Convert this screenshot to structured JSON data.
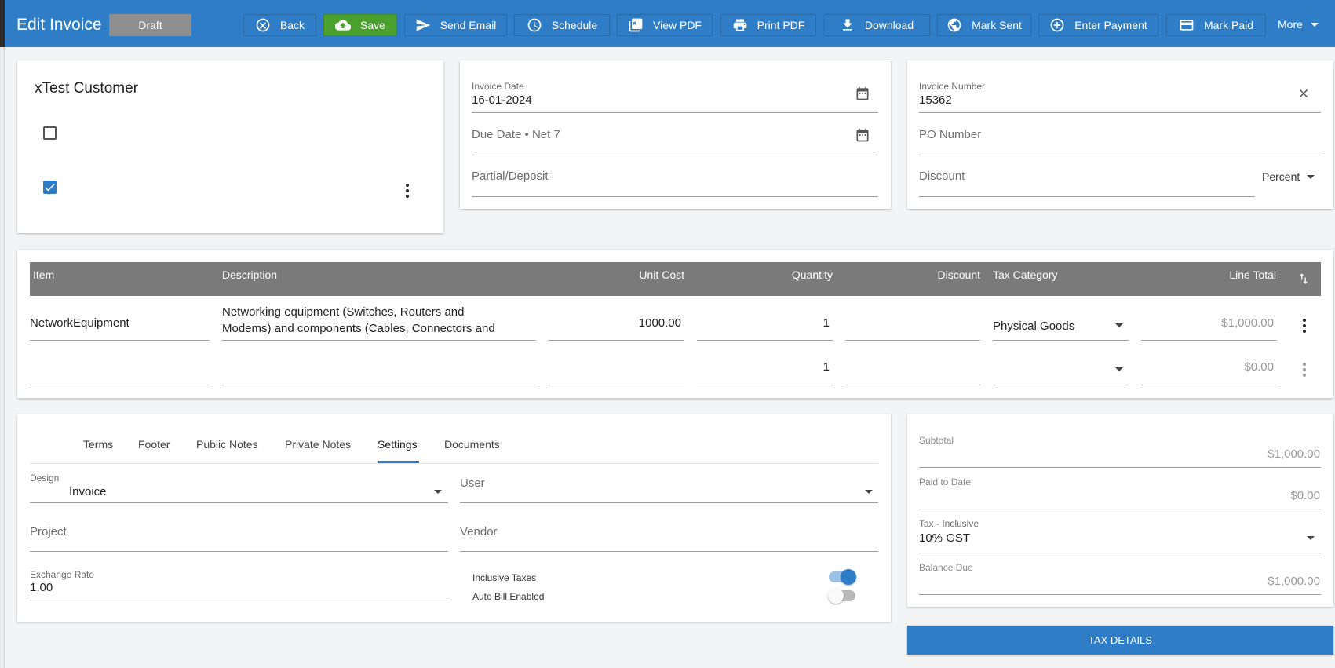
{
  "header": {
    "title": "Edit Invoice",
    "status": "Draft",
    "buttons": {
      "back": "Back",
      "save": "Save",
      "send_email": "Send Email",
      "schedule": "Schedule",
      "view_pdf": "View PDF",
      "print_pdf": "Print PDF",
      "download": "Download",
      "mark_sent": "Mark Sent",
      "enter_payment": "Enter Payment",
      "mark_paid": "Mark Paid",
      "more": "More"
    }
  },
  "customer": {
    "name": "xTest Customer",
    "checkbox1_checked": false,
    "checkbox2_checked": true
  },
  "dates": {
    "invoice_date_label": "Invoice Date",
    "invoice_date_value": "16-01-2024",
    "due_date_placeholder": "Due Date • Net 7",
    "partial_placeholder": "Partial/Deposit"
  },
  "numbers": {
    "invoice_number_label": "Invoice Number",
    "invoice_number_value": "15362",
    "po_placeholder": "PO Number",
    "discount_placeholder": "Discount",
    "discount_type": "Percent"
  },
  "items_table": {
    "headers": {
      "item": "Item",
      "description": "Description",
      "unit_cost": "Unit Cost",
      "quantity": "Quantity",
      "discount": "Discount",
      "tax_category": "Tax Category",
      "line_total": "Line Total"
    },
    "rows": [
      {
        "item": "NetworkEquipment",
        "description_line1": "Networking equipment (Switches, Routers and",
        "description_line2": "Modems) and components (Cables, Connectors and",
        "unit_cost": "1000.00",
        "quantity": "1",
        "discount": "",
        "tax_category": "Physical Goods",
        "line_total": "$1,000.00"
      },
      {
        "item": "",
        "description_line1": "",
        "description_line2": "",
        "unit_cost": "",
        "quantity": "1",
        "discount": "",
        "tax_category": "",
        "line_total": "$0.00"
      }
    ]
  },
  "tabs": {
    "terms": "Terms",
    "footer": "Footer",
    "public_notes": "Public Notes",
    "private_notes": "Private Notes",
    "settings": "Settings",
    "documents": "Documents",
    "active": "Settings"
  },
  "settings": {
    "design_label": "Design",
    "design_value": "Invoice",
    "user_placeholder": "User",
    "project_placeholder": "Project",
    "vendor_placeholder": "Vendor",
    "exchange_rate_label": "Exchange Rate",
    "exchange_rate_value": "1.00",
    "inclusive_taxes_label": "Inclusive Taxes",
    "inclusive_taxes_on": true,
    "auto_bill_label": "Auto Bill Enabled",
    "auto_bill_on": false
  },
  "totals": {
    "subtotal_label": "Subtotal",
    "subtotal_value": "$1,000.00",
    "paid_label": "Paid to Date",
    "paid_value": "$0.00",
    "tax_label": "Tax - Inclusive",
    "tax_value": "10% GST",
    "balance_label": "Balance Due",
    "balance_value": "$1,000.00",
    "tax_details_button": "TAX DETAILS"
  },
  "colors": {
    "brand_blue": "#2f7dc6",
    "save_green": "#4aa02c",
    "table_header": "#7a7a7a"
  }
}
